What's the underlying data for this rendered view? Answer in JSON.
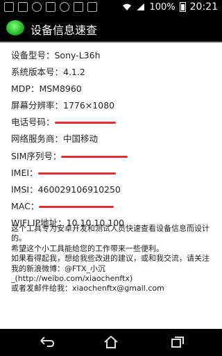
{
  "status_bar": {
    "battery_percent": "100%",
    "time": "20:21"
  },
  "app": {
    "title": "设备信息速查"
  },
  "info": {
    "model": "设备型号：Sony-L36h",
    "system_version": "系统版本号：4.1.2",
    "mdp": "MDP：MSM8960",
    "resolution": "屏幕分辨率：1776×1080",
    "phone_label": "电话号码：",
    "network": "网络服务商：中国移动",
    "sim_label": "SIM序列号：",
    "imei_label": "IMEI：",
    "imsi": "IMSI：460029106910250",
    "mac_label": "MAC：",
    "wifi_ip": "WIFI IP地址：10.10.10.100"
  },
  "description": {
    "line1": "这个工具专为安卓开发和测试人员快速查看设备信息而设计的。",
    "line2": "希望这个小工具能给您的工作带来一些便利。",
    "line3": "如果看得起我，想给我些改进的建议，或和我交流，请关注我的新浪微博：@FTX_小沉_(http://weibo.com/xiaochenftx)",
    "line4": "或者发邮件给我：xiaochenftx@gmail.com"
  },
  "colors": {
    "redaction": "#e03030",
    "app_icon": "#2ecc2e"
  },
  "icons": {
    "back": "back-icon",
    "home": "home-icon",
    "recent": "recent-apps-icon"
  }
}
